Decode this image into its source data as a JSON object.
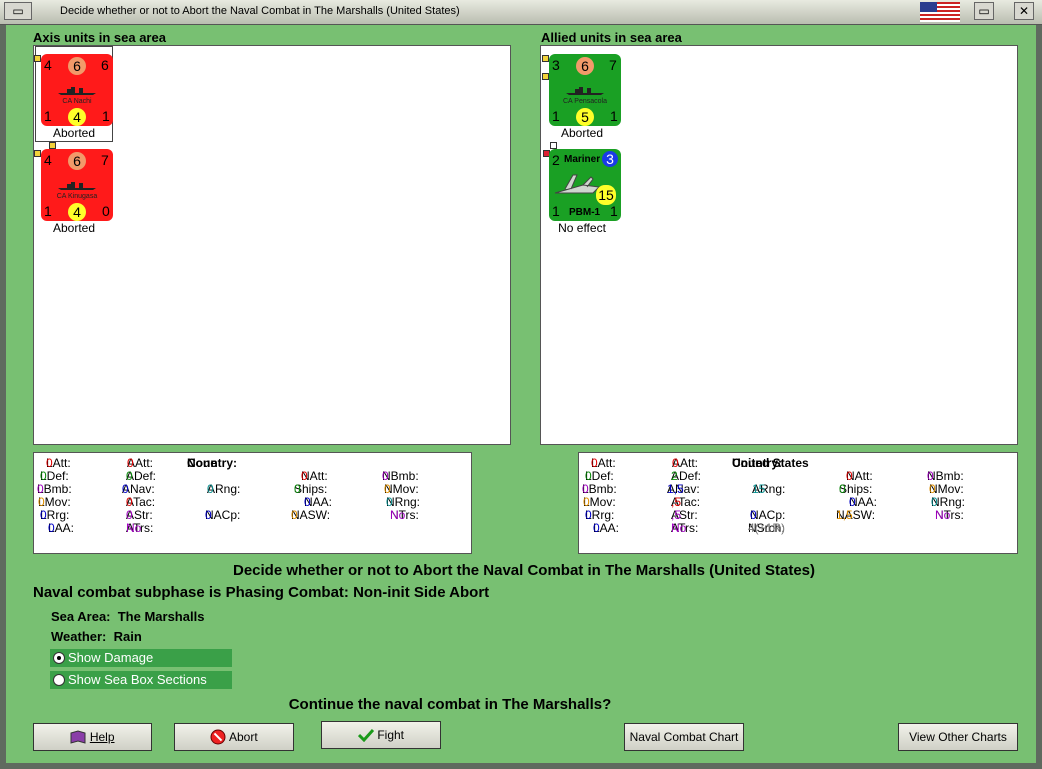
{
  "window": {
    "title": "Decide whether or not to Abort the Naval Combat in The Marshalls (United States)"
  },
  "axis": {
    "header": "Axis units in sea area",
    "units": [
      {
        "tl": "4",
        "tc": "6",
        "tr": "6",
        "name": "CA Nachi",
        "bl": "1",
        "bc": "4",
        "br": "1",
        "status": "Aborted"
      },
      {
        "tl": "4",
        "tc": "6",
        "tr": "7",
        "name": "CA Kinugasa",
        "bl": "1",
        "bc": "4",
        "br": "0",
        "status": "Aborted"
      }
    ]
  },
  "allied": {
    "header": "Allied units in sea area",
    "units": [
      {
        "tl": "3",
        "tc": "6",
        "tr": "7",
        "name": "CA Pensacola",
        "bl": "1",
        "bc": "5",
        "br": "1",
        "status": "Aborted"
      },
      {
        "tl": "2",
        "top_name": "Mariner",
        "tr": "3",
        "bc": "15",
        "name": "PBM-1",
        "bl": "1",
        "br": "1",
        "status": "No effect"
      }
    ]
  },
  "axis_stats": {
    "LAtt": "0",
    "LDef": "0",
    "LBmb": "0",
    "LMov": "0",
    "LRrg": "0",
    "LAA": "0",
    "AAtt": "0",
    "ADef": "0",
    "ANav": "0",
    "ATac": "0",
    "AStr": "0",
    "ATrs": "No",
    "country_label": "Country:",
    "country": "None",
    "ARng": "0",
    "NACp": "0",
    "NAtt": "0",
    "Ships": "0",
    "NAA": "0",
    "NASW": "0",
    "NBmb": "0",
    "NMov": "0",
    "NRng": "0",
    "NTrs": "No"
  },
  "allied_stats": {
    "LAtt": "0",
    "LDef": "0",
    "LBmb": "0",
    "LMov": "0",
    "LRrg": "0",
    "LAA": "0",
    "AAtt": "0",
    "ADef": "2",
    "ANav": "1,5",
    "ATac": ",5",
    "AStr": ",5",
    "ATrs": "No",
    "country_label": "Country:",
    "country": "United States",
    "ARng": "15",
    "NACp": "0",
    "NSrch": "4(+1R)",
    "NAtt": "0",
    "Ships": "0",
    "NAA": "0",
    "NASW": "1,5",
    "NBmb": "0",
    "NMov": "0",
    "NRng": "0",
    "NTrs": "No"
  },
  "labels": {
    "LAtt": "LAtt:",
    "LDef": "LDef:",
    "LBmb": "LBmb:",
    "LMov": "LMov:",
    "LRrg": "LRrg:",
    "LAA": "LAA:",
    "AAtt": "AAtt:",
    "ADef": "ADef:",
    "ANav": "ANav:",
    "ATac": "ATac:",
    "AStr": "AStr:",
    "ATrs": "ATrs:",
    "ARng": "ARng:",
    "NACp": "NACp:",
    "NSrch": "NSrch:",
    "NAtt": "NAtt:",
    "Ships": "Ships:",
    "NAA": "NAA:",
    "NASW": "NASW:",
    "NBmb": "NBmb:",
    "NMov": "NMov:",
    "NRng": "NRng:",
    "NTrs": "NTrs:"
  },
  "main": {
    "heading": "Decide whether or not to Abort the Naval Combat in The Marshalls (United States)",
    "subphase": "Naval combat subphase is Phasing Combat: Non-init Side Abort",
    "sea_area_label": "Sea Area:",
    "sea_area": "The Marshalls",
    "weather_label": "Weather:",
    "weather": "Rain",
    "show_damage": "Show Damage",
    "show_sea_box": "Show Sea Box Sections",
    "question": "Continue the naval combat in The Marshalls?"
  },
  "buttons": {
    "help": "Help",
    "abort": "Abort",
    "fight": "Fight",
    "naval_chart": "Naval Combat Chart",
    "other_charts": "View Other Charts"
  },
  "colors": {
    "axis_counter": "#ff1a1a",
    "allied_counter": "#1aa024",
    "accent_red": "#e00000",
    "accent_green": "#0a8a0a",
    "accent_blue": "#0000c8",
    "accent_purple": "#a000c0",
    "accent_teal": "#0a9090",
    "accent_orange": "#e09000"
  }
}
